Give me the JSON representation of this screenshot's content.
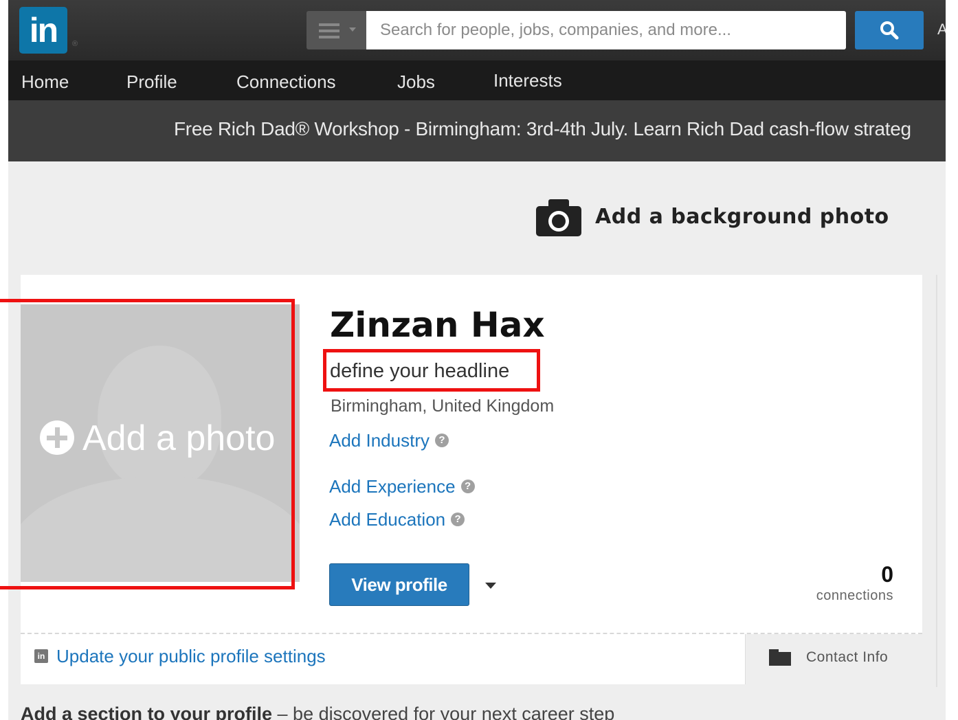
{
  "brand": {
    "logo_text": "in"
  },
  "search": {
    "placeholder": "Search for people, jobs, companies, and more..."
  },
  "topbar": {
    "edge_text": "A"
  },
  "nav": {
    "items": [
      "Home",
      "Profile",
      "Connections",
      "Jobs",
      "Interests"
    ]
  },
  "ad": {
    "text": "Free Rich Dad® Workshop - Birmingham: 3rd-4th July. Learn Rich Dad cash-flow strateg"
  },
  "background": {
    "label": "Add a background photo"
  },
  "profile": {
    "add_photo": "Add a photo",
    "name": "Zinzan Hax",
    "headline": "define your headline",
    "location": "Birmingham, United Kingdom",
    "add_industry": "Add Industry",
    "add_experience": "Add Experience",
    "add_education": "Add Education",
    "view_profile": "View profile",
    "connections_count": "0",
    "connections_label": "connections"
  },
  "footer": {
    "public_profile": "Update your public profile settings",
    "contact_info": "Contact Info"
  },
  "add_section": {
    "bold": "Add a section to your profile",
    "rest": " – be discovered for your next career step"
  },
  "colors": {
    "accent": "#287bbc",
    "link": "#1c75bc",
    "highlight": "#ee1111"
  }
}
